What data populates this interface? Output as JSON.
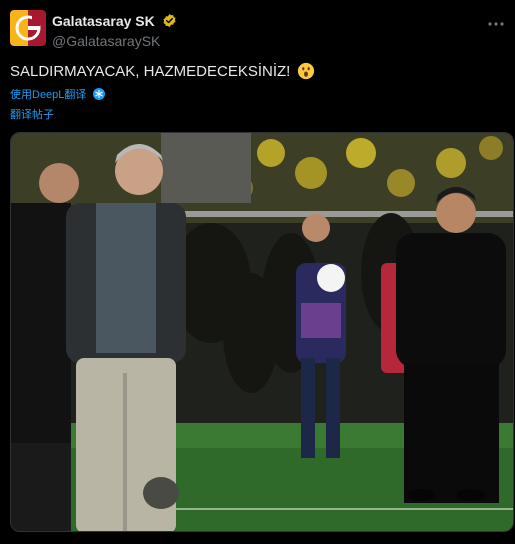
{
  "account": {
    "display_name": "Galatasaray SK",
    "handle": "@GalatasaraySK",
    "verified_icon": "verified-badge-icon",
    "logo_colors": [
      "#f7b318",
      "#a6192e"
    ]
  },
  "tweet": {
    "text": "SALDIRMAYACAK, HAZMEDECEKSİNİZ!",
    "emoji": "astonished-face-icon"
  },
  "translate": {
    "deepl_label": "使用DeepL翻译",
    "post_label": "翻译帖子"
  },
  "colors": {
    "background": "#000000",
    "link": "#1d9bf0",
    "text": "#e7e9ea",
    "muted": "#71767b"
  }
}
